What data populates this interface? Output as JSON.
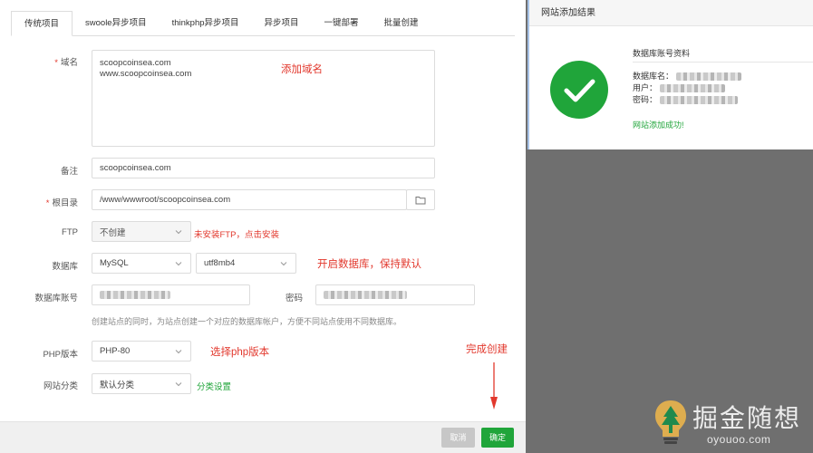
{
  "tabs": [
    "传统项目",
    "swoole异步项目",
    "thinkphp异步项目",
    "异步项目",
    "一键部署",
    "批量创建"
  ],
  "form": {
    "domain_label": "域名",
    "domain_value_1": "scoopcoinsea.com",
    "domain_value_2": "www.scoopcoinsea.com",
    "note_label": "备注",
    "note_value": "scoopcoinsea.com",
    "root_label": "根目录",
    "root_value": "/www/wwwroot/scoopcoinsea.com",
    "ftp_label": "FTP",
    "ftp_value": "不创建",
    "ftp_note": "未安装FTP，点击安装",
    "db_label": "数据库",
    "db_type": "MySQL",
    "db_charset": "utf8mb4",
    "db_account_label": "数据库账号",
    "db_password_label": "密码",
    "db_hint": "创建站点的同时，为站点创建一个对应的数据库帐户，方便不同站点使用不同数据库。",
    "php_label": "PHP版本",
    "php_value": "PHP-80",
    "category_label": "网站分类",
    "category_value": "默认分类",
    "category_link": "分类设置"
  },
  "annotations": {
    "domain": "添加域名",
    "database": "开启数据库，保持默认",
    "php": "选择php版本",
    "finish": "完成创建"
  },
  "footer": {
    "cancel": "取消",
    "confirm": "确定"
  },
  "modal": {
    "title": "网站添加结果",
    "section": "数据库账号资料",
    "db_name_label": "数据库名：",
    "user_label": "用户：",
    "password_label": "密码：",
    "success": "网站添加成功!"
  },
  "watermark": {
    "title": "掘金随想",
    "sub": "oyouoo.com"
  },
  "colors": {
    "accent_green": "#20a53a",
    "annotation_red": "#e2382d"
  }
}
